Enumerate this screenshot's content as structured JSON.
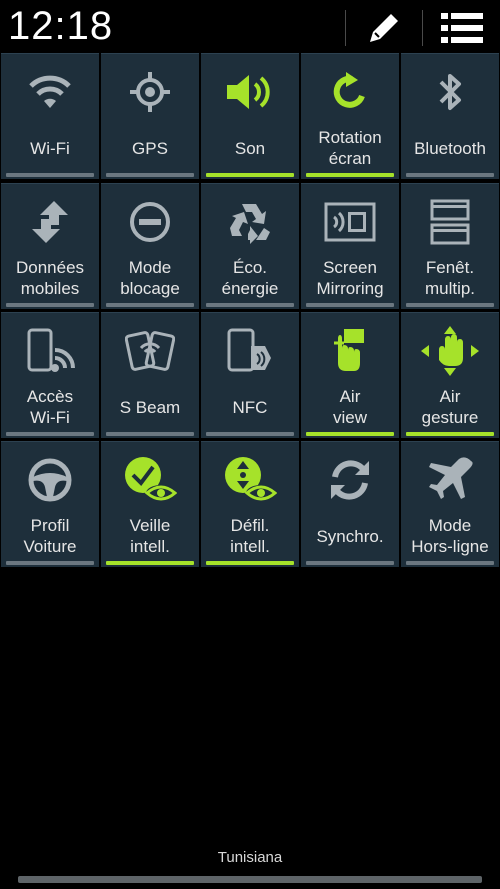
{
  "status": {
    "time": "12:18"
  },
  "header": {
    "edit_icon": "pencil-icon",
    "list_icon": "list-icon"
  },
  "colors": {
    "active": "#a6e22a",
    "inactive_icon": "#aab3b9",
    "tile_bg": "#1e2f3b"
  },
  "tiles": [
    {
      "label": "Wi-Fi",
      "icon": "wifi-icon",
      "active": false
    },
    {
      "label": "GPS",
      "icon": "gps-icon",
      "active": false
    },
    {
      "label": "Son",
      "icon": "speaker-icon",
      "active": true
    },
    {
      "label": "Rotation\nécran",
      "icon": "rotation-icon",
      "active": true
    },
    {
      "label": "Bluetooth",
      "icon": "bluetooth-icon",
      "active": false
    },
    {
      "label": "Données\nmobiles",
      "icon": "mobile-data-icon",
      "active": false
    },
    {
      "label": "Mode\nblocage",
      "icon": "blocking-icon",
      "active": false
    },
    {
      "label": "Éco.\nénergie",
      "icon": "recycle-icon",
      "active": false
    },
    {
      "label": "Screen\nMirroring",
      "icon": "screen-mirroring-icon",
      "active": false
    },
    {
      "label": "Fenêt.\nmultip.",
      "icon": "multi-window-icon",
      "active": false
    },
    {
      "label": "Accès\nWi-Fi",
      "icon": "hotspot-icon",
      "active": false
    },
    {
      "label": "S Beam",
      "icon": "s-beam-icon",
      "active": false
    },
    {
      "label": "NFC",
      "icon": "nfc-icon",
      "active": false
    },
    {
      "label": "Air\nview",
      "icon": "air-view-icon",
      "active": true
    },
    {
      "label": "Air\ngesture",
      "icon": "air-gesture-icon",
      "active": true
    },
    {
      "label": "Profil\nVoiture",
      "icon": "steering-wheel-icon",
      "active": false
    },
    {
      "label": "Veille\nintell.",
      "icon": "smart-stay-icon",
      "active": true
    },
    {
      "label": "Défil.\nintell.",
      "icon": "smart-scroll-icon",
      "active": true
    },
    {
      "label": "Synchro.",
      "icon": "sync-icon",
      "active": false
    },
    {
      "label": "Mode\nHors-ligne",
      "icon": "airplane-icon",
      "active": false
    }
  ],
  "carrier": "Tunisiana"
}
